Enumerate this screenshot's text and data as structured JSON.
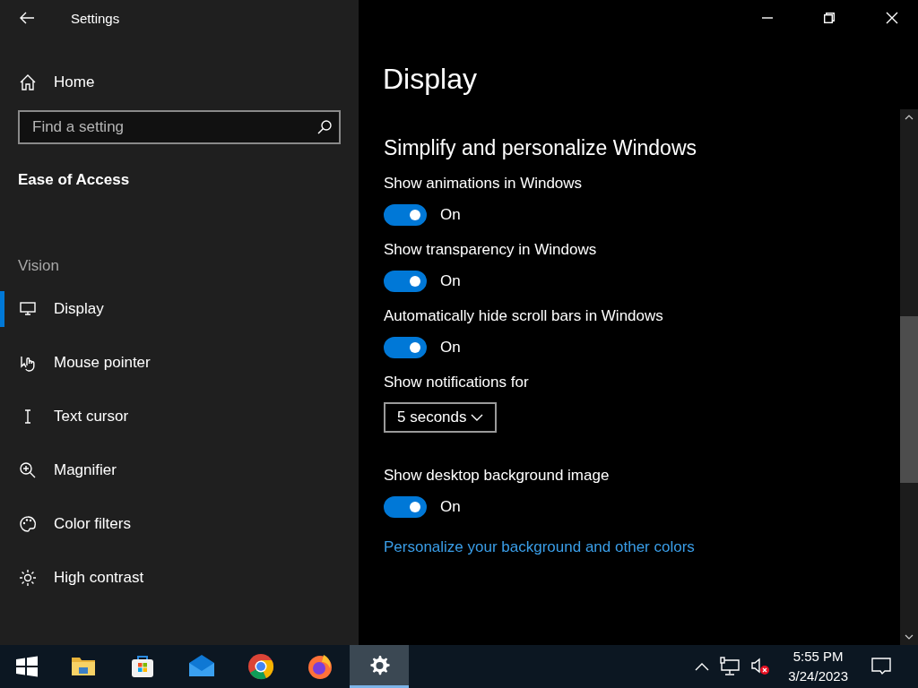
{
  "window": {
    "title": "Settings"
  },
  "sidebar": {
    "home": "Home",
    "search": {
      "placeholder": "Find a setting"
    },
    "category": "Ease of Access",
    "section": "Vision",
    "items": [
      {
        "label": "Display",
        "selected": true
      },
      {
        "label": "Mouse pointer",
        "selected": false
      },
      {
        "label": "Text cursor",
        "selected": false
      },
      {
        "label": "Magnifier",
        "selected": false
      },
      {
        "label": "Color filters",
        "selected": false
      },
      {
        "label": "High contrast",
        "selected": false
      }
    ]
  },
  "content": {
    "page_title": "Display",
    "section_title": "Simplify and personalize Windows",
    "settings": [
      {
        "kind": "toggle",
        "label": "Show animations in Windows",
        "on": true,
        "state_text": "On"
      },
      {
        "kind": "toggle",
        "label": "Show transparency in Windows",
        "on": true,
        "state_text": "On"
      },
      {
        "kind": "toggle",
        "label": "Automatically hide scroll bars in Windows",
        "on": true,
        "state_text": "On"
      },
      {
        "kind": "dropdown",
        "label": "Show notifications for",
        "value": "5 seconds"
      },
      {
        "kind": "toggle",
        "label": "Show desktop background image",
        "on": true,
        "state_text": "On"
      }
    ],
    "link": "Personalize your background and other colors"
  },
  "taskbar": {
    "apps": [
      {
        "selected": false
      },
      {
        "selected": false
      },
      {
        "selected": false
      },
      {
        "selected": false
      },
      {
        "selected": false
      },
      {
        "selected": true
      }
    ],
    "time": "5:55 PM",
    "date": "3/24/2023"
  }
}
